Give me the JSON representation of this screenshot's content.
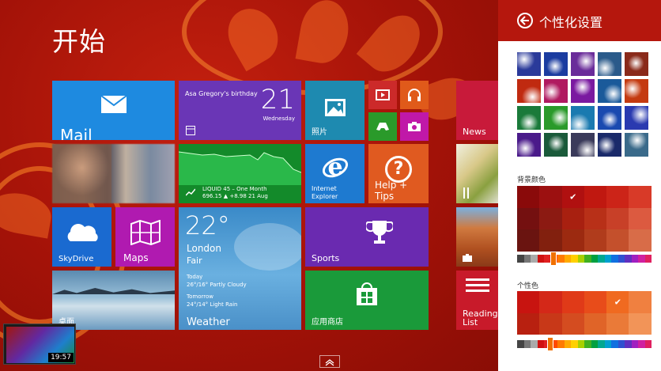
{
  "start": {
    "title": "开始",
    "tiles": {
      "mail_label": "Mail",
      "calendar_event": "Asa Gregory's birthday",
      "calendar_day": "21",
      "calendar_weekday": "Wednesday",
      "photos_label": "照片",
      "finance_line1": "LIQUID 45 – One Month",
      "finance_line2": "696.15 ▲ +8.98 21 Aug",
      "ie_label_line1": "Internet",
      "ie_label_line2": "Explorer",
      "help_label": "Help + Tips",
      "skydrive_label": "SkyDrive",
      "maps_label": "Maps",
      "weather_temp": "22°",
      "weather_city": "London",
      "weather_cond": "Fair",
      "weather_today_label": "Today",
      "weather_today": "26°/16° Partly Cloudy",
      "weather_tomorrow_label": "Tomorrow",
      "weather_tomorrow": "24°/14° Light Rain",
      "weather_label": "Weather",
      "sports_label": "Sports",
      "desktop_label": "桌面",
      "store_label": "应用商店",
      "news_label": "News",
      "reading_label": "Reading List"
    },
    "video_time": "19:57"
  },
  "charm": {
    "title": "个性化设置",
    "bg_color_label": "背景颜色",
    "accent_label": "个性色",
    "bg_swatches": [
      "#8a0a0a",
      "#9c1010",
      "#b01010",
      "#c01810",
      "#cc2418",
      "#d83a28",
      "#741010",
      "#8c1a12",
      "#a82010",
      "#b83018",
      "#c84028",
      "#dc5a40",
      "#6a1410",
      "#82200e",
      "#9c2a10",
      "#b03c1c",
      "#c4502c",
      "#d86c48"
    ],
    "bg_checked": 2,
    "accent_swatches": [
      "#c81410",
      "#d42818",
      "#e03a18",
      "#e84c1a",
      "#f06a20",
      "#f08040",
      "#b82010",
      "#c83818",
      "#d44c20",
      "#e06428",
      "#ea7a38",
      "#f29458"
    ],
    "accent_checked": 4,
    "hue_colors": [
      "#444",
      "#777",
      "#aaa",
      "#d01010",
      "#e02020",
      "#ff4a00",
      "#ff7a00",
      "#ffaa00",
      "#ffd000",
      "#a8d000",
      "#40b020",
      "#00a040",
      "#00a890",
      "#00a0d0",
      "#1070e0",
      "#3050d0",
      "#6030c0",
      "#a020c0",
      "#d020a0",
      "#e02060"
    ],
    "patterns": [
      "#2a3a9a",
      "#1b3ca0",
      "#6a2c9a",
      "#2a5a8a",
      "#8a2a1a",
      "#c02a10",
      "#b01a60",
      "#7a1aa0",
      "#1a5a9a",
      "#c43a10",
      "#1a7a3a",
      "#2a9a2a",
      "#1a7ab0",
      "#1a4ab0",
      "#2a3ab0",
      "#4a1a8a",
      "#1a5a3a",
      "#3a3a5a",
      "#1a2a6a",
      "#3a6a8a"
    ]
  }
}
